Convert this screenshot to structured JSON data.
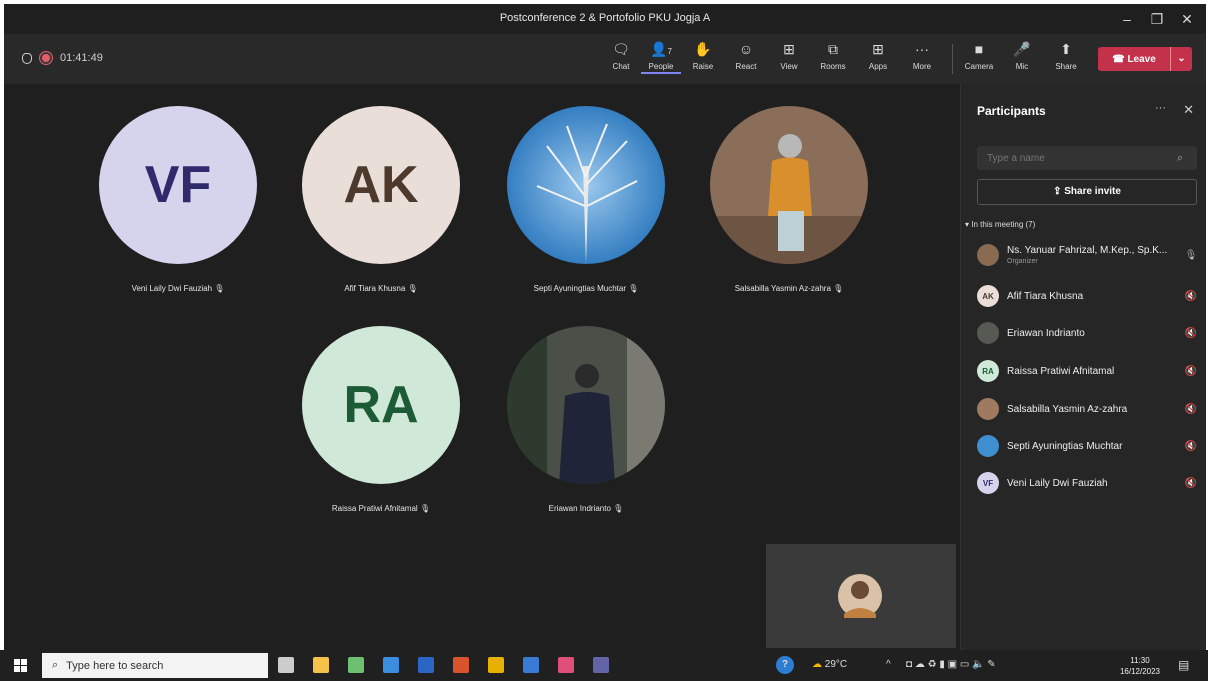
{
  "window": {
    "title": "Postconference 2 & Portofolio PKU Jogja A",
    "controls": [
      "–",
      "❐",
      "✕"
    ]
  },
  "meeting": {
    "timer": "01:41:49"
  },
  "toolbar": {
    "items": [
      {
        "label": "Chat",
        "icon": "chat-icon"
      },
      {
        "label": "People",
        "icon": "people-icon",
        "badge": "7"
      },
      {
        "label": "Raise",
        "icon": "hand-icon"
      },
      {
        "label": "React",
        "icon": "smile-icon"
      },
      {
        "label": "View",
        "icon": "grid-icon"
      },
      {
        "label": "Rooms",
        "icon": "rooms-icon"
      },
      {
        "label": "Apps",
        "icon": "plus-icon"
      },
      {
        "label": "More",
        "icon": "more-icon"
      },
      {
        "label": "Camera",
        "icon": "camera-off-icon"
      },
      {
        "label": "Mic",
        "icon": "mic-icon"
      },
      {
        "label": "Share",
        "icon": "share-icon"
      }
    ],
    "leave_label": "Leave"
  },
  "stage": {
    "tiles": [
      {
        "initials": "VF",
        "name": "Veni Laily Dwi Fauziah",
        "bg": "#d6d3ec",
        "fg": "#2f2a6b"
      },
      {
        "initials": "AK",
        "name": "Afif Tiara Khusna",
        "bg": "#eaded8",
        "fg": "#4e3a2c"
      },
      {
        "initials": "",
        "name": "Septi Ayuningtias Muchtar",
        "bg": "#3f8ed0",
        "fg": ""
      },
      {
        "initials": "",
        "name": "Salsabilla Yasmin Az-zahra",
        "bg": "#8a6e5a",
        "fg": ""
      },
      {
        "initials": "RA",
        "name": "Raissa Pratiwi Afnitamal",
        "bg": "#cfe8d8",
        "fg": "#1d5a36"
      },
      {
        "initials": "",
        "name": "Eriawan Indrianto",
        "bg": "#3a3f3a",
        "fg": ""
      }
    ]
  },
  "panel": {
    "title": "Participants",
    "search_placeholder": "Type a name",
    "invite_label": "Share invite",
    "section_label": "In this meeting (7)",
    "people": [
      {
        "name": "Ns. Yanuar Fahrizal, M.Kep., Sp.K...",
        "role": "Organizer",
        "avatar": "",
        "av_bg": "#8a6a50",
        "av_fg": "#fff",
        "mic": "🎙"
      },
      {
        "name": "Afif Tiara Khusna",
        "role": "",
        "avatar": "AK",
        "av_bg": "#eaded8",
        "av_fg": "#4e3a2c",
        "mic": "🔇"
      },
      {
        "name": "Eriawan Indrianto",
        "role": "",
        "avatar": "",
        "av_bg": "#565a52",
        "av_fg": "#fff",
        "mic": "🔇"
      },
      {
        "name": "Raissa Pratiwi Afnitamal",
        "role": "",
        "avatar": "RA",
        "av_bg": "#cfe8d8",
        "av_fg": "#1d5a36",
        "mic": "🔇"
      },
      {
        "name": "Salsabilla Yasmin Az-zahra",
        "role": "",
        "avatar": "",
        "av_bg": "#a07a60",
        "av_fg": "#fff",
        "mic": "🔇"
      },
      {
        "name": "Septi Ayuningtias Muchtar",
        "role": "",
        "avatar": "",
        "av_bg": "#3f8ed0",
        "av_fg": "#fff",
        "mic": "🔇"
      },
      {
        "name": "Veni Laily Dwi Fauziah",
        "role": "",
        "avatar": "VF",
        "av_bg": "#d6d3ec",
        "av_fg": "#2f2a6b",
        "mic": "🔇"
      }
    ]
  },
  "taskbar": {
    "search_placeholder": "Type here to search",
    "weather": "29°C",
    "time": "11:30",
    "date": "16/12/2023",
    "apps": [
      {
        "name": "task-view",
        "color": "#cccccc"
      },
      {
        "name": "file-explorer",
        "color": "#f5c24a"
      },
      {
        "name": "notes",
        "color": "#6cc070"
      },
      {
        "name": "mail",
        "color": "#3b8de0"
      },
      {
        "name": "word",
        "color": "#2b66c4"
      },
      {
        "name": "powerpoint",
        "color": "#d9542c"
      },
      {
        "name": "chrome",
        "color": "#e8b000"
      },
      {
        "name": "app",
        "color": "#3a7bd5"
      },
      {
        "name": "calendar",
        "color": "#e04e7a"
      },
      {
        "name": "teams",
        "color": "#6264a7"
      }
    ]
  }
}
